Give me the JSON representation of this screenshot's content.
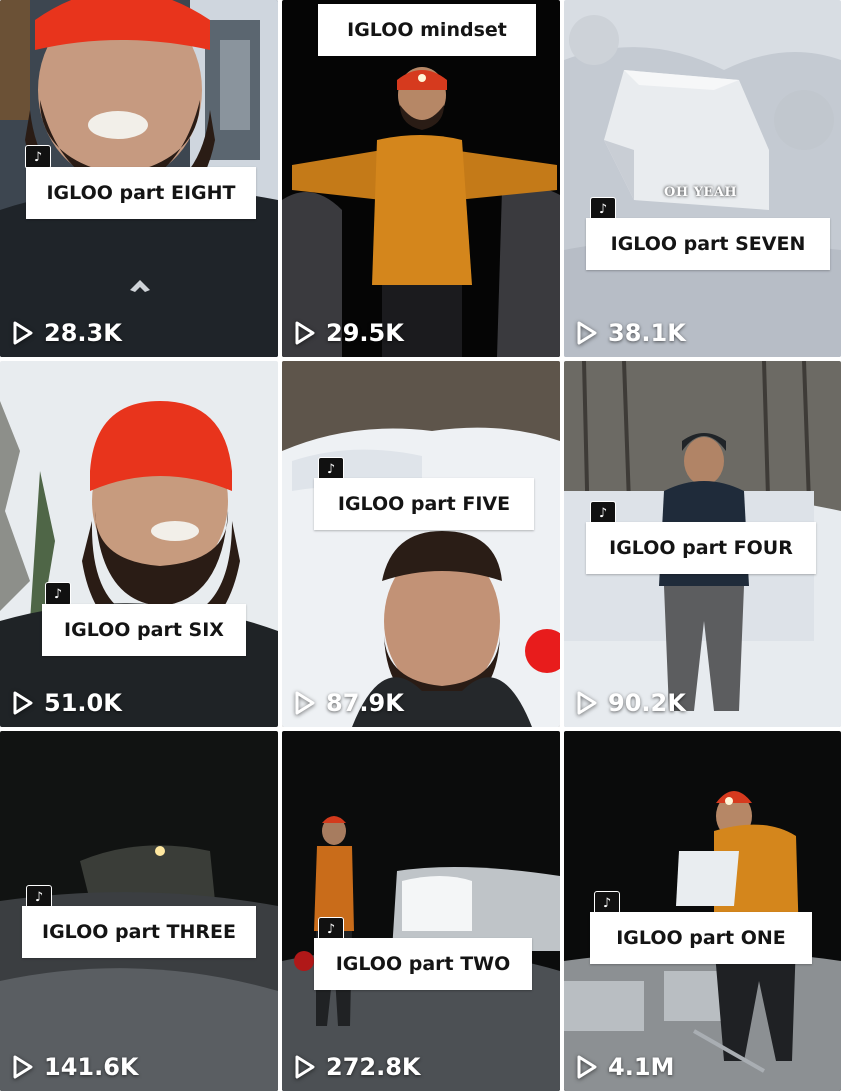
{
  "videos": [
    {
      "title": "IGLOO part EIGHT",
      "views": "28.3K"
    },
    {
      "title": "IGLOO mindset",
      "views": "29.5K"
    },
    {
      "title": "IGLOO part SEVEN",
      "views": "38.1K",
      "overlay": "OH YEAH"
    },
    {
      "title": "IGLOO part SIX",
      "views": "51.0K"
    },
    {
      "title": "IGLOO part FIVE",
      "views": "87.9K"
    },
    {
      "title": "IGLOO part FOUR",
      "views": "90.2K"
    },
    {
      "title": "IGLOO part THREE",
      "views": "141.6K"
    },
    {
      "title": "IGLOO part TWO",
      "views": "272.8K"
    },
    {
      "title": "IGLOO part ONE",
      "views": "4.1M"
    }
  ],
  "icons": {
    "badge": "tiktok-logo-icon",
    "play": "play-outline-icon"
  },
  "colors": {
    "label_bg": "#ffffff",
    "label_text": "#141414",
    "beanie": "#e8341c",
    "jacket": "#d9861a"
  }
}
